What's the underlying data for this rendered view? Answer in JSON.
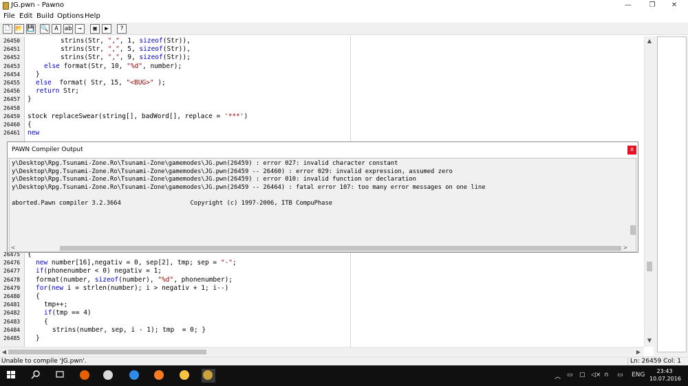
{
  "window": {
    "title": "JG.pwn - Pawno",
    "minimize": "—",
    "maximize": "❐",
    "close": "✕"
  },
  "menu": [
    "File",
    "Edit",
    "Build",
    "Options",
    "Help"
  ],
  "toolbar": {
    "buttons": [
      {
        "name": "new-icon",
        "glyph": "🗋"
      },
      {
        "name": "open-icon",
        "glyph": "📂"
      },
      {
        "name": "save-icon",
        "glyph": "💾"
      },
      {
        "name": "find-icon",
        "glyph": "🔍"
      },
      {
        "name": "find-next-icon",
        "glyph": "A"
      },
      {
        "name": "replace-icon",
        "glyph": "ab"
      },
      {
        "name": "goto-icon",
        "glyph": "→"
      },
      {
        "name": "compile-icon",
        "glyph": "▣"
      },
      {
        "name": "run-icon",
        "glyph": "▶"
      },
      {
        "name": "help-icon",
        "glyph": "?"
      }
    ]
  },
  "editor": {
    "top_lines": [
      {
        "n": "26450",
        "indent": 8,
        "parts": [
          [
            "",
            "strins(Str, "
          ],
          [
            "str",
            "\",\""
          ],
          [
            "",
            ", 1, "
          ],
          [
            "kw",
            "sizeof"
          ],
          [
            "",
            "(Str)),"
          ]
        ]
      },
      {
        "n": "26451",
        "indent": 8,
        "parts": [
          [
            "",
            "strins(Str, "
          ],
          [
            "str",
            "\",\""
          ],
          [
            "",
            ", 5, "
          ],
          [
            "kw",
            "sizeof"
          ],
          [
            "",
            "(Str)),"
          ]
        ]
      },
      {
        "n": "26452",
        "indent": 8,
        "parts": [
          [
            "",
            "strins(Str, "
          ],
          [
            "str",
            "\",\""
          ],
          [
            "",
            ", 9, "
          ],
          [
            "kw",
            "sizeof"
          ],
          [
            "",
            "(Str));"
          ]
        ]
      },
      {
        "n": "26453",
        "indent": 4,
        "parts": [
          [
            "kw",
            "else"
          ],
          [
            "",
            " format(Str, 10, "
          ],
          [
            "str",
            "\"%d\""
          ],
          [
            "",
            ", number);"
          ]
        ]
      },
      {
        "n": "26454",
        "indent": 2,
        "parts": [
          [
            "",
            "}"
          ]
        ]
      },
      {
        "n": "26455",
        "indent": 2,
        "parts": [
          [
            "kw",
            "else"
          ],
          [
            "",
            "  format( Str, 15, "
          ],
          [
            "str",
            "\"<BUG>\""
          ],
          [
            "",
            " );"
          ]
        ]
      },
      {
        "n": "26456",
        "indent": 2,
        "parts": [
          [
            "kw",
            "return"
          ],
          [
            "",
            " Str;"
          ]
        ]
      },
      {
        "n": "26457",
        "indent": 0,
        "parts": [
          [
            "",
            "}"
          ]
        ]
      },
      {
        "n": "26458",
        "indent": 0,
        "parts": [
          [
            "",
            ""
          ]
        ]
      },
      {
        "n": "26459",
        "indent": 0,
        "parts": [
          [
            "",
            "stock replaceSwear(string[], badWord[], replace = "
          ],
          [
            "str",
            "'***'"
          ],
          [
            "",
            ")"
          ]
        ]
      },
      {
        "n": "26460",
        "indent": 0,
        "parts": [
          [
            "",
            "{"
          ]
        ]
      },
      {
        "n": "26461",
        "indent": 0,
        "parts": [
          [
            "kw",
            "new"
          ]
        ]
      }
    ],
    "bottom_lines": [
      {
        "n": "26475",
        "indent": 0,
        "parts": [
          [
            "",
            "{"
          ]
        ]
      },
      {
        "n": "26476",
        "indent": 2,
        "parts": [
          [
            "kw",
            "new"
          ],
          [
            "",
            " number[16],negativ = 0, sep[2], tmp; sep = "
          ],
          [
            "str",
            "\"-\""
          ],
          [
            "",
            ";"
          ]
        ]
      },
      {
        "n": "26477",
        "indent": 2,
        "parts": [
          [
            "kw",
            "if"
          ],
          [
            "",
            "(phonenumber < 0) negativ = 1;"
          ]
        ]
      },
      {
        "n": "26478",
        "indent": 2,
        "parts": [
          [
            "",
            "format(number, "
          ],
          [
            "kw",
            "sizeof"
          ],
          [
            "",
            "(number), "
          ],
          [
            "str",
            "\"%d\""
          ],
          [
            "",
            ", phonenumber);"
          ]
        ]
      },
      {
        "n": "26479",
        "indent": 2,
        "parts": [
          [
            "kw",
            "for"
          ],
          [
            "",
            "("
          ],
          [
            "kw",
            "new"
          ],
          [
            "",
            " i = strlen(number); i > negativ + 1; i--)"
          ]
        ]
      },
      {
        "n": "26480",
        "indent": 2,
        "parts": [
          [
            "",
            "{"
          ]
        ]
      },
      {
        "n": "26481",
        "indent": 4,
        "parts": [
          [
            "",
            "tmp++;"
          ]
        ]
      },
      {
        "n": "26482",
        "indent": 4,
        "parts": [
          [
            "kw",
            "if"
          ],
          [
            "",
            "(tmp == 4)"
          ]
        ]
      },
      {
        "n": "26483",
        "indent": 4,
        "parts": [
          [
            "",
            "{"
          ]
        ]
      },
      {
        "n": "26484",
        "indent": 6,
        "parts": [
          [
            "",
            "strins(number, sep, i - 1); tmp  = 0; }"
          ]
        ]
      },
      {
        "n": "26485",
        "indent": 2,
        "parts": [
          [
            "",
            "}"
          ]
        ]
      }
    ]
  },
  "compiler": {
    "title": "PAWN Compiler Output",
    "close": "x",
    "lines": [
      "y\\Desktop\\Rpg.Tsunami-Zone.Ro\\Tsunami-Zone\\gamemodes\\JG.pwn(26459) : error 027: invalid character constant",
      "y\\Desktop\\Rpg.Tsunami-Zone.Ro\\Tsunami-Zone\\gamemodes\\JG.pwn(26459 -- 26460) : error 029: invalid expression, assumed zero",
      "y\\Desktop\\Rpg.Tsunami-Zone.Ro\\Tsunami-Zone\\gamemodes\\JG.pwn(26459) : error 010: invalid function or declaration",
      "y\\Desktop\\Rpg.Tsunami-Zone.Ro\\Tsunami-Zone\\gamemodes\\JG.pwn(26459 -- 26464) : fatal error 107: too many error messages on one line",
      "",
      "aborted.Pawn compiler 3.2.3664                   Copyright (c) 1997-2006, ITB CompuPhase"
    ]
  },
  "status": {
    "message": "Unable to compile 'JG.pwn'.",
    "position": "Ln: 26459  Col: 1"
  },
  "taskbar": {
    "apps": [
      {
        "name": "start-icon",
        "color": "#ffffff"
      },
      {
        "name": "search-icon",
        "color": "#ffffff"
      },
      {
        "name": "task-view-icon",
        "color": "#ffffff"
      },
      {
        "name": "firefox-icon",
        "color": "#e66000"
      },
      {
        "name": "app-icon",
        "color": "#d9d9d9"
      },
      {
        "name": "edge-icon",
        "color": "#2f8ce5"
      },
      {
        "name": "xampp-icon",
        "color": "#fb7a24"
      },
      {
        "name": "folder-icon",
        "color": "#f5c242"
      },
      {
        "name": "pawno-icon",
        "color": "#c9a23a"
      }
    ],
    "tray": {
      "lang": "ENG",
      "time": "23:43",
      "date": "10.07.2016"
    }
  },
  "accent": "#e81123"
}
